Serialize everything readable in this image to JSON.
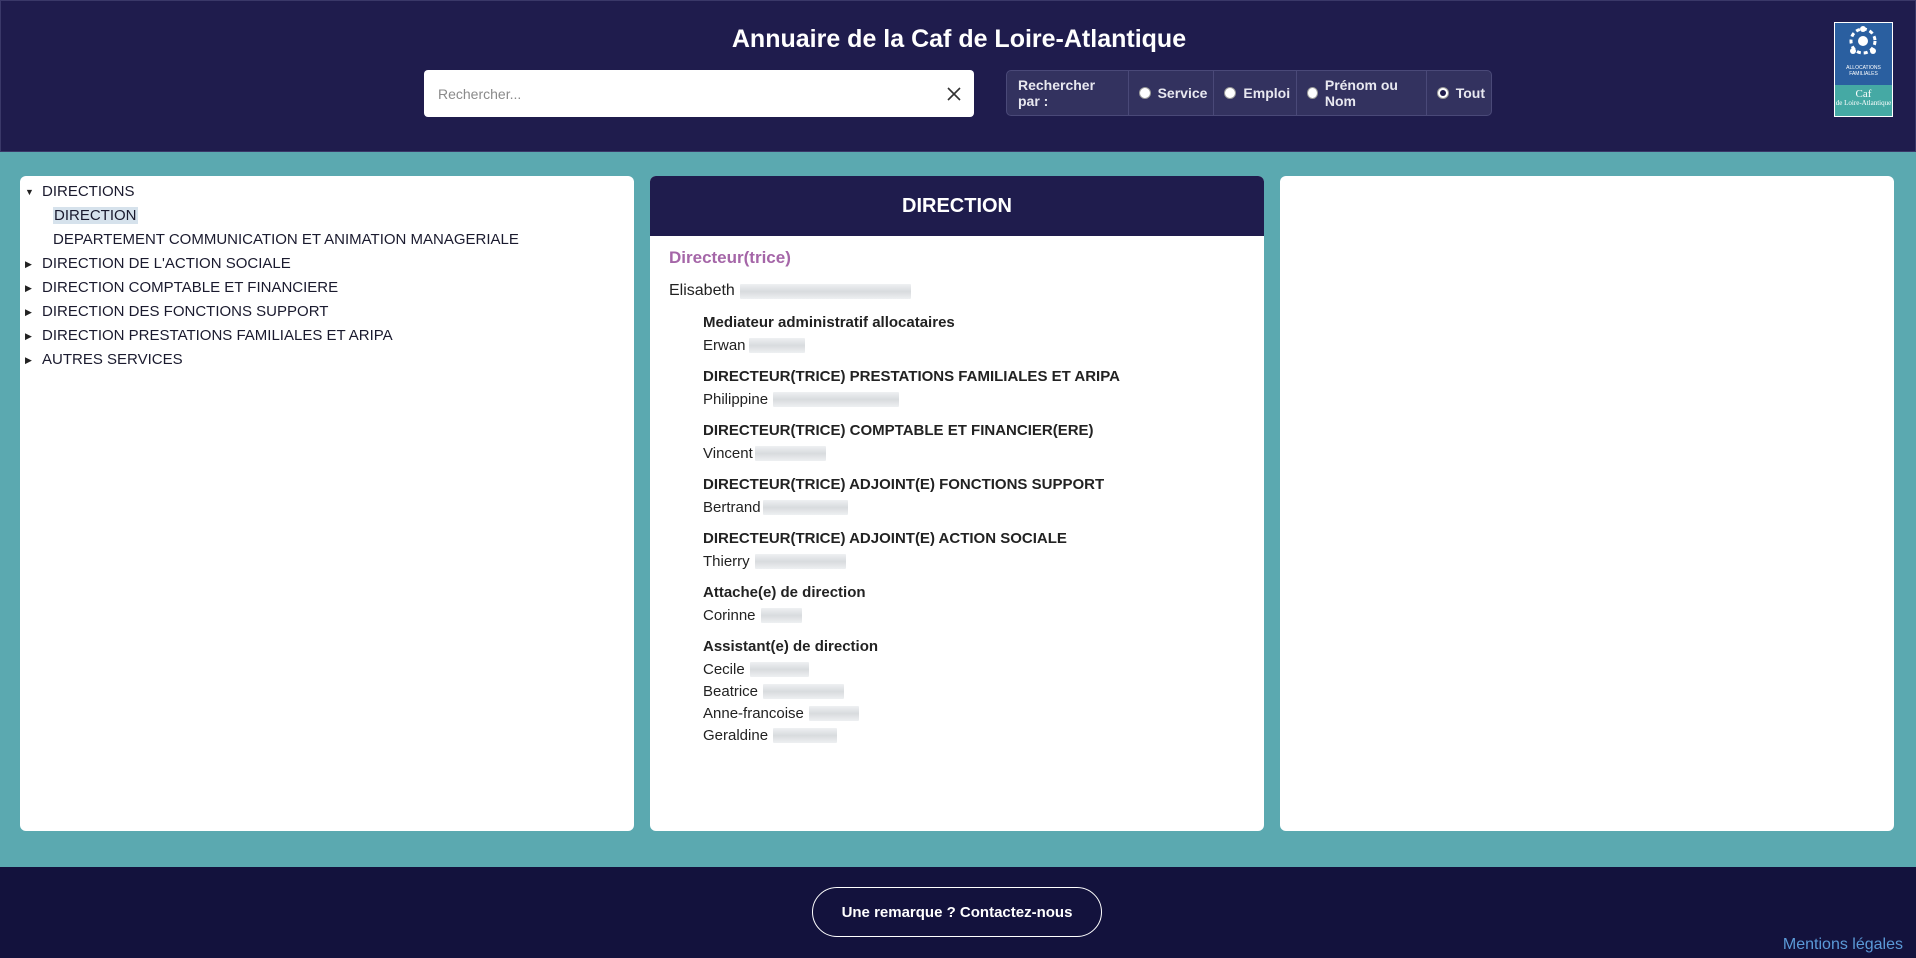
{
  "header": {
    "title": "Annuaire de la Caf de Loire-Atlantique",
    "search": {
      "placeholder": "Rechercher...",
      "value": ""
    },
    "filter": {
      "label": "Rechercher par :",
      "options": [
        "Service",
        "Emploi",
        "Prénom ou Nom",
        "Tout"
      ],
      "selected": "Tout"
    },
    "logo": {
      "top_text": "ALLOCATIONS FAMILIALES",
      "name": "Caf",
      "sub": "de Loire-Atlantique"
    }
  },
  "tree": {
    "root": "DIRECTIONS",
    "children": [
      "DIRECTION",
      "DEPARTEMENT COMMUNICATION ET ANIMATION MANAGERIALE"
    ],
    "selected_child": "DIRECTION",
    "siblings": [
      "DIRECTION DE L'ACTION SOCIALE",
      "DIRECTION COMPTABLE ET FINANCIERE",
      "DIRECTION DES FONCTIONS SUPPORT",
      "DIRECTION PRESTATIONS FAMILIALES ET ARIPA",
      "AUTRES SERVICES"
    ]
  },
  "main": {
    "title": "DIRECTION",
    "head_role": "Directeur(trice)",
    "head_person": "Elisabeth",
    "roles": [
      {
        "role": "Mediateur administratif allocataires",
        "people": [
          "Erwan"
        ]
      },
      {
        "role": "DIRECTEUR(TRICE) PRESTATIONS FAMILIALES ET ARIPA",
        "people": [
          "Philippine"
        ]
      },
      {
        "role": "DIRECTEUR(TRICE) COMPTABLE ET FINANCIER(ERE)",
        "people": [
          "Vincent"
        ]
      },
      {
        "role": "DIRECTEUR(TRICE) ADJOINT(E) FONCTIONS SUPPORT",
        "people": [
          "Bertrand"
        ]
      },
      {
        "role": "DIRECTEUR(TRICE) ADJOINT(E) ACTION SOCIALE",
        "people": [
          "Thierry"
        ]
      },
      {
        "role": "Attache(e) de direction",
        "people": [
          "Corinne"
        ]
      },
      {
        "role": "Assistant(e) de direction",
        "people": [
          "Cecile",
          "Beatrice",
          "Anne-francoise",
          "Geraldine"
        ]
      }
    ]
  },
  "footer": {
    "contact": "Une remarque ? Contactez-nous",
    "legal": "Mentions légales"
  }
}
